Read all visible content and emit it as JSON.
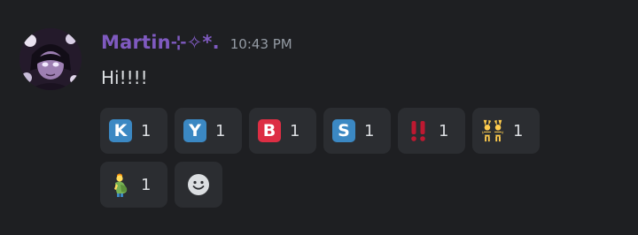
{
  "message": {
    "author": "Martin⊹✧*.",
    "timestamp": "10:43 PM",
    "content": "Hi!!!!",
    "author_color": "#7f5ac0"
  },
  "reactions": [
    {
      "emoji_name": "regional-indicator-k-icon",
      "glyph": "K",
      "tile_color": "#3b88c3",
      "count": "1"
    },
    {
      "emoji_name": "regional-indicator-y-icon",
      "glyph": "Y",
      "tile_color": "#3b88c3",
      "count": "1"
    },
    {
      "emoji_name": "b-button-blood-type-icon",
      "glyph": "B",
      "tile_color": "#dd2e44",
      "count": "1"
    },
    {
      "emoji_name": "regional-indicator-s-icon",
      "glyph": "S",
      "tile_color": "#3b88c3",
      "count": "1"
    },
    {
      "emoji_name": "double-exclamation-icon",
      "count": "1"
    },
    {
      "emoji_name": "people-with-bunny-ears-icon",
      "count": "1"
    },
    {
      "emoji_name": "pregnant-man-icon",
      "count": "1"
    }
  ],
  "add_reaction": {
    "icon": "smiley-add-reaction-icon"
  },
  "colors": {
    "background": "#1e1f22",
    "reaction_bg": "#2b2d31",
    "timestamp": "#949ba4",
    "text": "#dbdee1"
  }
}
